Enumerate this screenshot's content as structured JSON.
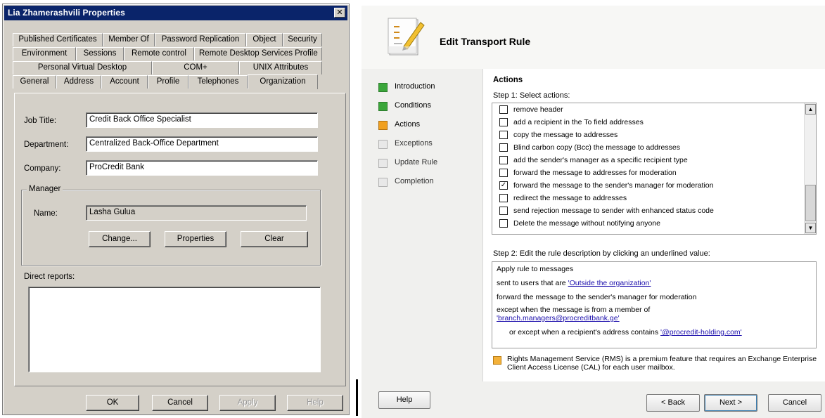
{
  "properties_dialog": {
    "title": "Lia Zhamerashvili Properties",
    "close_glyph": "✕",
    "tab_rows": [
      [
        "Published Certificates",
        "Member Of",
        "Password Replication",
        "Object",
        "Security"
      ],
      [
        "Environment",
        "Sessions",
        "Remote control",
        "Remote Desktop Services Profile"
      ],
      [
        "Personal Virtual Desktop",
        "COM+",
        "UNIX Attributes"
      ],
      [
        "General",
        "Address",
        "Account",
        "Profile",
        "Telephones",
        "Organization"
      ]
    ],
    "active_tab": "Organization",
    "fields": {
      "job_title_label": "Job Title:",
      "job_title_value": "Credit Back Office Specialist",
      "department_label": "Department:",
      "department_value": "Centralized Back-Office Department",
      "company_label": "Company:",
      "company_value": "ProCredit Bank"
    },
    "manager": {
      "group_label": "Manager",
      "name_label": "Name:",
      "name_value": "Lasha Gulua",
      "change_button": "Change...",
      "properties_button": "Properties",
      "clear_button": "Clear"
    },
    "direct_reports_label": "Direct reports:",
    "footer_buttons": {
      "ok": "OK",
      "cancel": "Cancel",
      "apply": "Apply",
      "help": "Help"
    }
  },
  "wizard": {
    "title": "Edit Transport Rule",
    "nav": [
      {
        "label": "Introduction",
        "state": "done"
      },
      {
        "label": "Conditions",
        "state": "done"
      },
      {
        "label": "Actions",
        "state": "current"
      },
      {
        "label": "Exceptions",
        "state": "pending"
      },
      {
        "label": "Update Rule",
        "state": "pending"
      },
      {
        "label": "Completion",
        "state": "pending"
      }
    ],
    "section_title": "Actions",
    "step1_label": "Step 1: Select actions:",
    "actions": [
      {
        "label": "remove header",
        "checked": false
      },
      {
        "label": "add a recipient in the To field addresses",
        "checked": false
      },
      {
        "label": "copy the message to addresses",
        "checked": false
      },
      {
        "label": "Blind carbon copy (Bcc) the message to addresses",
        "checked": false
      },
      {
        "label": "add the sender's manager as a specific recipient type",
        "checked": false
      },
      {
        "label": "forward the message to addresses for moderation",
        "checked": false
      },
      {
        "label": "forward the message to the sender's manager for moderation",
        "checked": true
      },
      {
        "label": "redirect the message to addresses",
        "checked": false
      },
      {
        "label": "send rejection message to sender with enhanced status code",
        "checked": false
      },
      {
        "label": "Delete the message without notifying anyone",
        "checked": false
      }
    ],
    "step2_label": "Step 2: Edit the rule description by clicking an underlined value:",
    "description": {
      "line1": "Apply rule to messages",
      "line2_prefix": "sent to users that are ",
      "line2_link": "'Outside the organization'",
      "line3": "forward the message to the sender's manager for moderation",
      "line4": "except when the message is from a member of",
      "line5_link": "'branch.managers@procreditbank.ge'",
      "line6_prefix": "or except when a recipient's address contains ",
      "line6_link": "'@procredit-holding.com'"
    },
    "info_text": "Rights Management Service (RMS) is a premium feature that requires an Exchange Enterprise Client Access License (CAL) for each user mailbox.",
    "buttons": {
      "help": "Help",
      "back": "< Back",
      "next": "Next >",
      "cancel": "Cancel"
    }
  }
}
